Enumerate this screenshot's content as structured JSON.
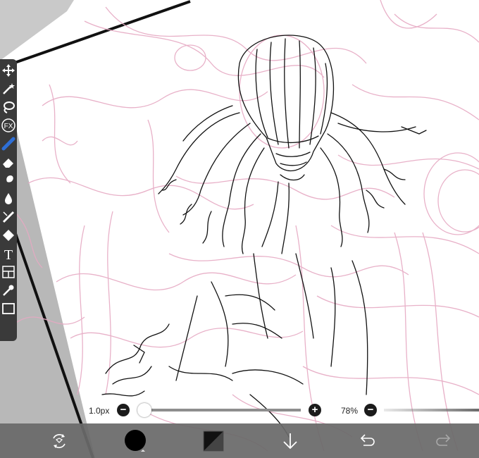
{
  "app": {
    "accent_color": "#2e6fd6",
    "toolbar_color": "#3a3a3a",
    "bottom_bar_color": "#696969"
  },
  "tools": [
    {
      "name": "transform",
      "icon": "move-arrows-icon"
    },
    {
      "name": "magic-wand",
      "icon": "magic-wand-icon"
    },
    {
      "name": "lasso",
      "icon": "lasso-icon"
    },
    {
      "name": "filter",
      "icon": "fx-icon",
      "label": "FX"
    },
    {
      "name": "brush",
      "icon": "brush-icon",
      "selected": true
    },
    {
      "name": "eraser",
      "icon": "eraser-icon"
    },
    {
      "name": "smudge",
      "icon": "smudge-icon"
    },
    {
      "name": "fill",
      "icon": "droplet-icon"
    },
    {
      "name": "blur",
      "icon": "blur-icon"
    },
    {
      "name": "shape",
      "icon": "diamond-icon"
    },
    {
      "name": "text",
      "icon": "text-icon",
      "label": "T"
    },
    {
      "name": "frame-divider",
      "icon": "frame-icon"
    },
    {
      "name": "eyedropper",
      "icon": "eyedropper-icon"
    },
    {
      "name": "canvas",
      "icon": "canvas-icon"
    }
  ],
  "brush_size": {
    "value_text": "1.0px",
    "minus": "−",
    "plus": "+",
    "level": 0.0
  },
  "opacity": {
    "value_text": "78%",
    "minus": "−",
    "level": 0.78
  },
  "bottom_bar": {
    "items": [
      {
        "name": "transform-menu",
        "icon": "transform-icon"
      },
      {
        "name": "color",
        "icon": "color-circle-icon",
        "color": "#000000"
      },
      {
        "name": "layer",
        "icon": "layer-thumbnail-icon"
      },
      {
        "name": "save",
        "icon": "arrow-down-icon"
      },
      {
        "name": "undo",
        "icon": "undo-icon"
      },
      {
        "name": "redo",
        "icon": "redo-icon"
      }
    ]
  }
}
